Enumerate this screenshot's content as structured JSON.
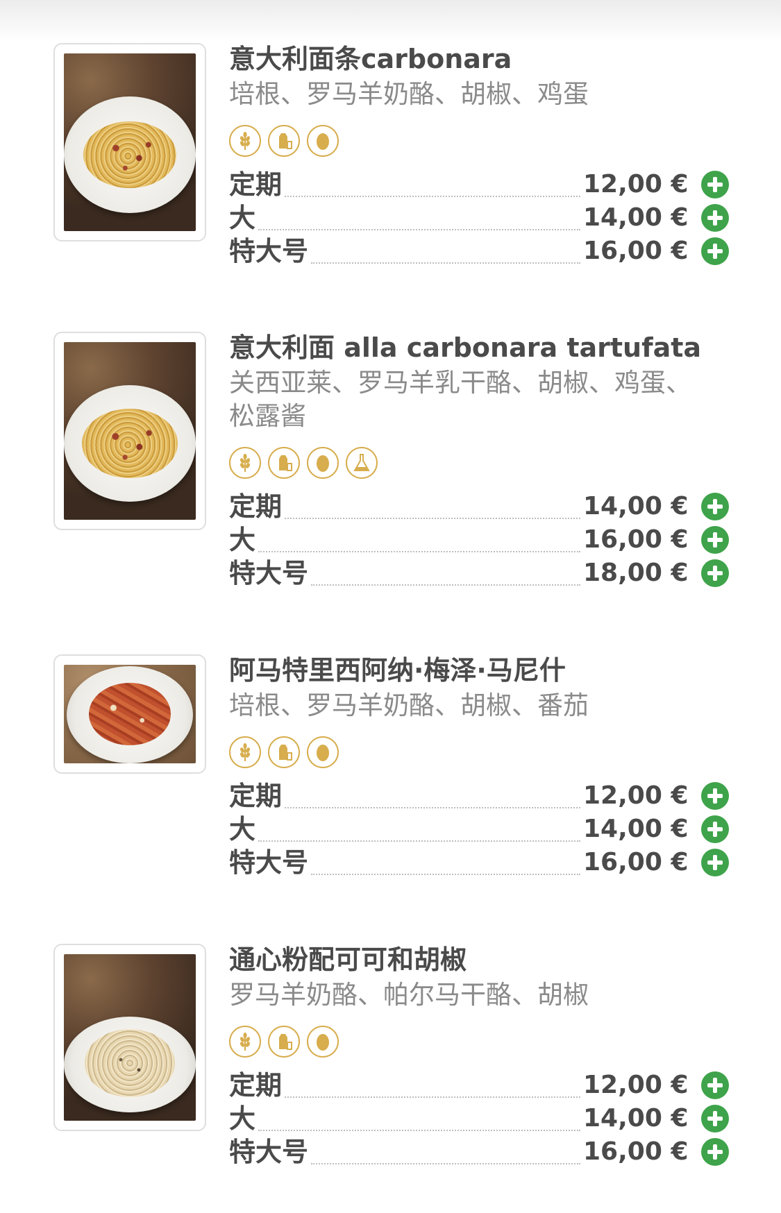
{
  "colors": {
    "accent_green": "#3ea34a",
    "allergen_gold": "#d7ad4d",
    "title": "#4a4a4a",
    "description": "#8a8a8a"
  },
  "items": [
    {
      "title": "意大利面条carbonara",
      "description": "培根、罗马羊奶酪、胡椒、鸡蛋",
      "photo": "carbonara-photo",
      "allergens": [
        "gluten-icon",
        "dairy-icon",
        "egg-icon"
      ],
      "prices": [
        {
          "size": "定期",
          "price": "12,00 €"
        },
        {
          "size": "大",
          "price": "14,00 €"
        },
        {
          "size": "特大号",
          "price": "16,00 €"
        }
      ]
    },
    {
      "title": "意大利面 alla carbonara tartufata",
      "description": "关西亚莱、罗马羊乳干酪、胡椒、鸡蛋、松露酱",
      "photo": "truffle-carbonara-photo",
      "allergens": [
        "gluten-icon",
        "dairy-icon",
        "egg-icon",
        "sulphites-icon"
      ],
      "prices": [
        {
          "size": "定期",
          "price": "14,00 €"
        },
        {
          "size": "大",
          "price": "16,00 €"
        },
        {
          "size": "特大号",
          "price": "18,00 €"
        }
      ]
    },
    {
      "title": "阿马特里西阿纳·梅泽·马尼什",
      "description": "培根、罗马羊奶酪、胡椒、番茄",
      "photo": "amatriciana-photo",
      "allergens": [
        "gluten-icon",
        "dairy-icon",
        "egg-icon"
      ],
      "prices": [
        {
          "size": "定期",
          "price": "12,00 €"
        },
        {
          "size": "大",
          "price": "14,00 €"
        },
        {
          "size": "特大号",
          "price": "16,00 €"
        }
      ]
    },
    {
      "title": "通心粉配可可和胡椒",
      "description": "罗马羊奶酪、帕尔马干酪、胡椒",
      "photo": "cacio-e-pepe-photo",
      "allergens": [
        "gluten-icon",
        "dairy-icon",
        "egg-icon"
      ],
      "prices": [
        {
          "size": "定期",
          "price": "12,00 €"
        },
        {
          "size": "大",
          "price": "14,00 €"
        },
        {
          "size": "特大号",
          "price": "16,00 €"
        }
      ]
    }
  ]
}
